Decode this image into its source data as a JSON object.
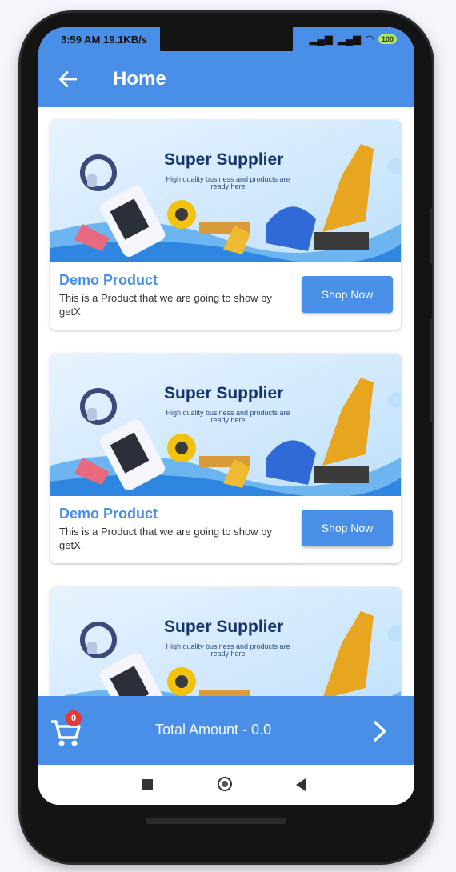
{
  "status_bar": {
    "time": "3:59 AM",
    "speed": "19.1KB/s",
    "battery": "100"
  },
  "app_bar": {
    "title": "Home",
    "back_icon": "arrow-left-icon"
  },
  "products": [
    {
      "banner_title": "Super Supplier",
      "banner_subtitle": "High quality business and products are ready here",
      "name": "Demo Product",
      "description": "This is a Product that we are going to show by getX",
      "button_label": "Shop Now"
    },
    {
      "banner_title": "Super Supplier",
      "banner_subtitle": "High quality business and products are ready here",
      "name": "Demo Product",
      "description": "This is a Product that we are going to show by getX",
      "button_label": "Shop Now"
    },
    {
      "banner_title": "Super Supplier",
      "banner_subtitle": "High quality business and products are ready here"
    }
  ],
  "bottom_bar": {
    "cart_count": "0",
    "total_label": "Total Amount - 0.0",
    "cart_icon": "shopping-cart-icon",
    "next_icon": "chevron-right-icon"
  },
  "nav_bar": {
    "icons": [
      "square-recents-icon",
      "circle-home-icon",
      "triangle-back-icon"
    ]
  },
  "colors": {
    "primary": "#4a8fe7",
    "badge": "#e53935",
    "banner_title": "#13336b"
  }
}
